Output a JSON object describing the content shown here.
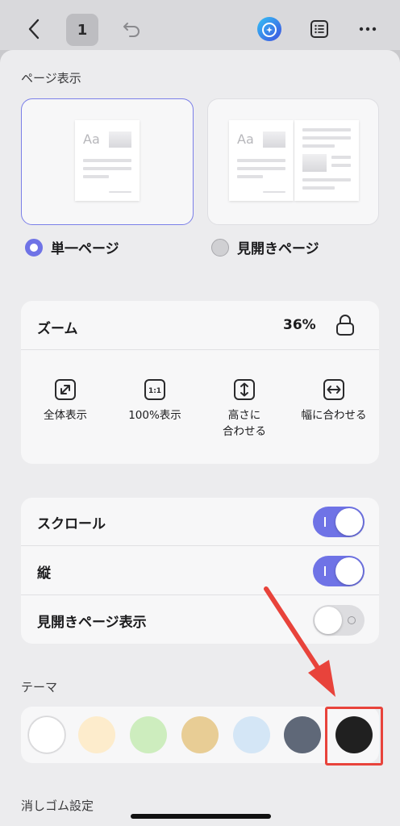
{
  "toolbar": {
    "page_number": "1",
    "icons": [
      "chevron-left-icon",
      "undo-icon",
      "ai-assistant-icon",
      "outline-list-icon",
      "more-icon"
    ]
  },
  "page_display": {
    "section_label": "ページ表示",
    "options": [
      {
        "label": "単一ページ",
        "selected": true
      },
      {
        "label": "見開きページ",
        "selected": false
      }
    ],
    "thumb_text": "Aa"
  },
  "zoom": {
    "title": "ズーム",
    "value": "36%",
    "options": [
      {
        "label": "全体表示",
        "icon": "fit-all-icon"
      },
      {
        "label": "100%表示",
        "icon": "actual-size-icon",
        "icon_text": "1:1"
      },
      {
        "label": "高さに\n合わせる",
        "icon": "fit-height-icon"
      },
      {
        "label": "幅に合わせる",
        "icon": "fit-width-icon"
      }
    ]
  },
  "toggles": [
    {
      "label": "スクロール",
      "on": true
    },
    {
      "label": "縦",
      "on": true
    },
    {
      "label": "見開きページ表示",
      "on": false
    }
  ],
  "theme": {
    "section_label": "テーマ",
    "swatches": [
      "#ffffff",
      "#fdeccc",
      "#cdedbe",
      "#e8cd95",
      "#d4e6f6",
      "#5f6878",
      "#202020"
    ],
    "selected_index": 6
  },
  "eraser": {
    "section_label": "消しゴム設定"
  },
  "colors": {
    "accent": "#6f73e6",
    "annotation": "#e8433b"
  }
}
